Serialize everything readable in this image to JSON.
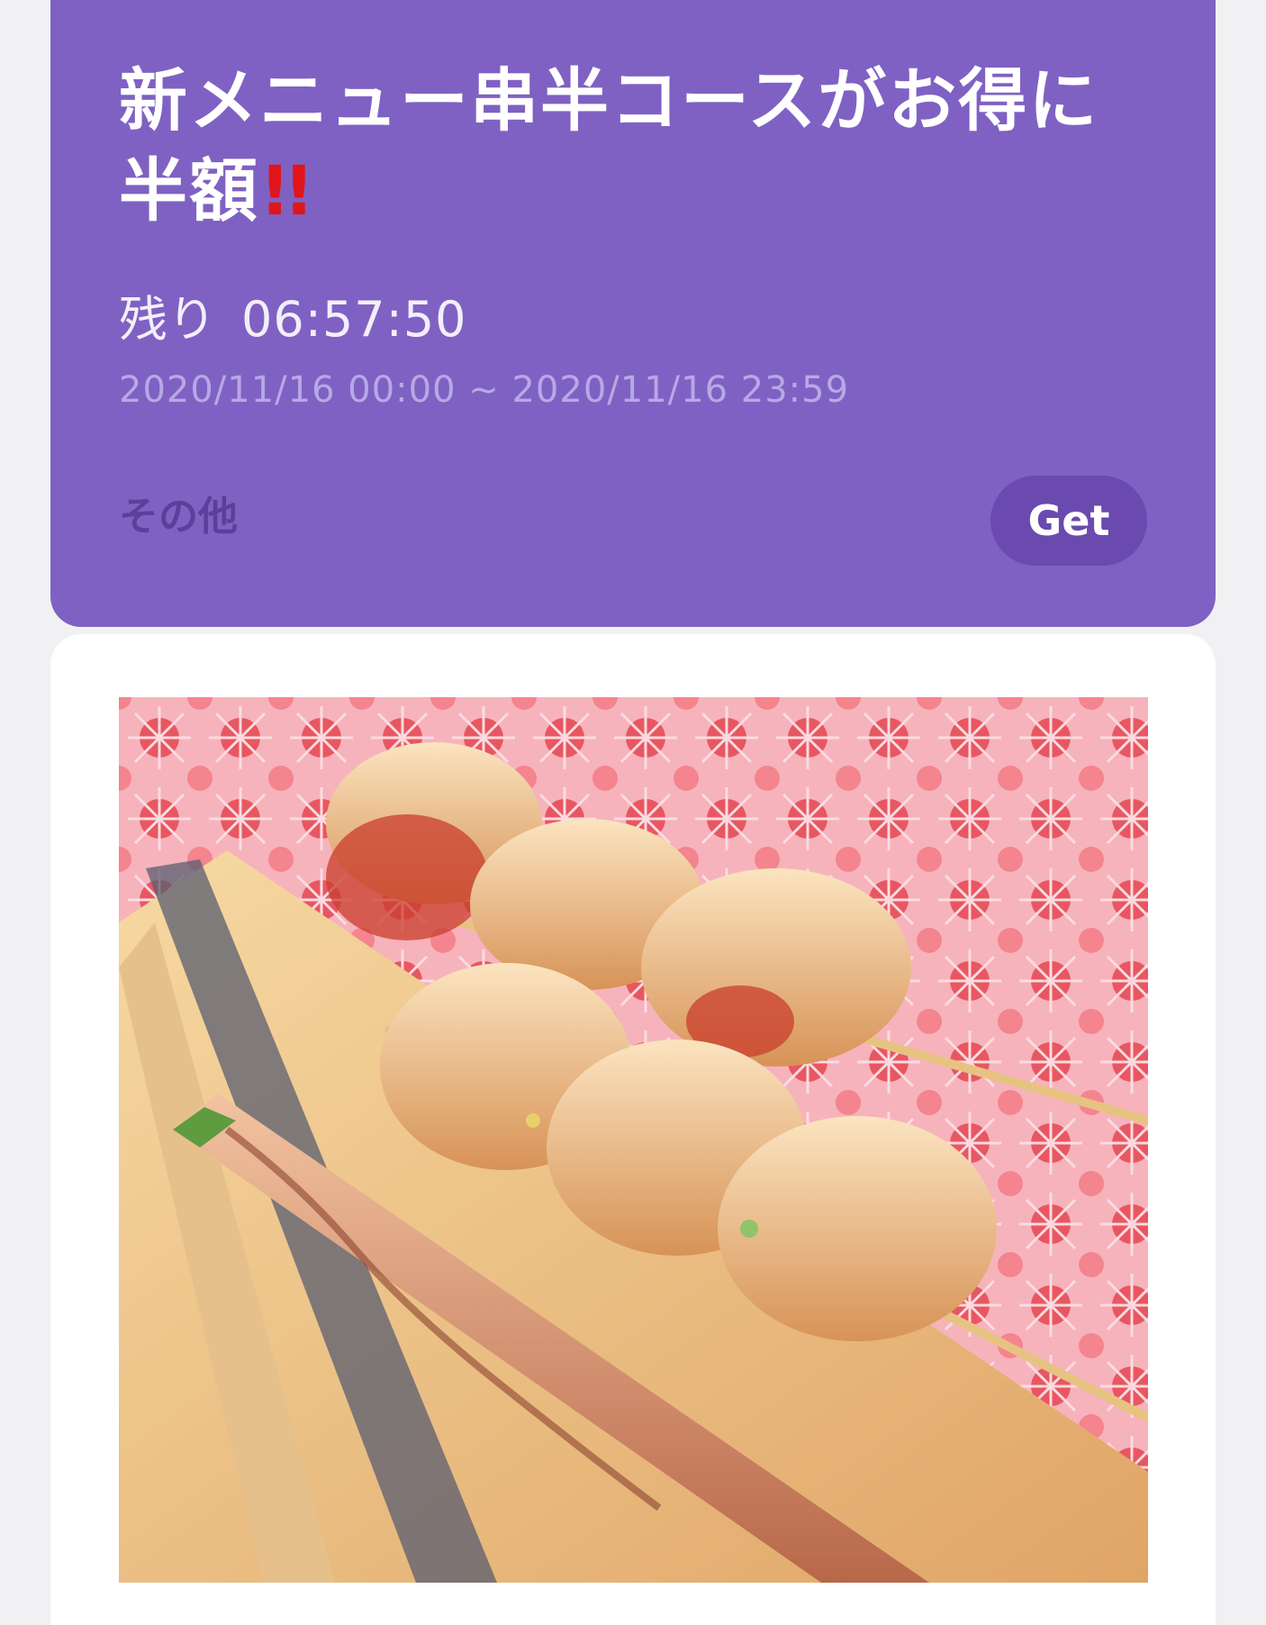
{
  "coupon": {
    "title_line1": "新メニュー串半コースがお得に",
    "title_line2": "半額",
    "title_emoji": "!!",
    "remaining_label": "残り",
    "remaining_time": "06:57:50",
    "period": "2020/11/16 00:00 ~ 2020/11/16 23:59",
    "category": "その他",
    "get_label": "Get",
    "colors": {
      "card_background": "#7f61c3",
      "button_background": "#6a4aae",
      "emoji": "#e0161b"
    }
  },
  "detail": {
    "image_icon": "food-photo-yakitori-skewers"
  }
}
